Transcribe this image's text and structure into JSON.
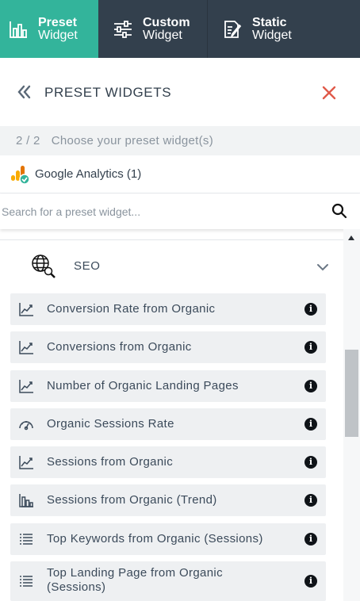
{
  "tabs": [
    {
      "line1": "Preset",
      "line2": "Widget",
      "active": true,
      "icon": "bar-chart-icon"
    },
    {
      "line1": "Custom",
      "line2": "Widget",
      "active": false,
      "icon": "sliders-icon"
    },
    {
      "line1": "Static",
      "line2": "Widget",
      "active": false,
      "icon": "edit-note-icon"
    }
  ],
  "header": {
    "title": "PRESET WIDGETS"
  },
  "step": {
    "count": "2 / 2",
    "text": "Choose your preset widget(s)"
  },
  "source": {
    "label": "Google Analytics (1)",
    "icon": "google-analytics-icon"
  },
  "search": {
    "placeholder": "Search for a preset widget..."
  },
  "category": {
    "label": "SEO",
    "icon": "seo-globe-icon",
    "expanded": true
  },
  "items": [
    {
      "label": "Conversion Rate from Organic",
      "icon": "line-chart-icon"
    },
    {
      "label": "Conversions from Organic",
      "icon": "line-chart-icon"
    },
    {
      "label": "Number of Organic Landing Pages",
      "icon": "line-chart-icon"
    },
    {
      "label": "Organic Sessions Rate",
      "icon": "gauge-icon"
    },
    {
      "label": "Sessions from Organic",
      "icon": "line-chart-icon"
    },
    {
      "label": "Sessions from Organic (Trend)",
      "icon": "bar-chart-icon"
    },
    {
      "label": "Top Keywords from Organic (Sessions)",
      "icon": "list-icon"
    },
    {
      "label": "Top Landing Page from Organic (Sessions)",
      "icon": "list-icon"
    }
  ],
  "colors": {
    "accent": "#33b49b",
    "tabbar": "#33404d",
    "close": "#e05a4a",
    "item_bg": "#eef0f2"
  }
}
